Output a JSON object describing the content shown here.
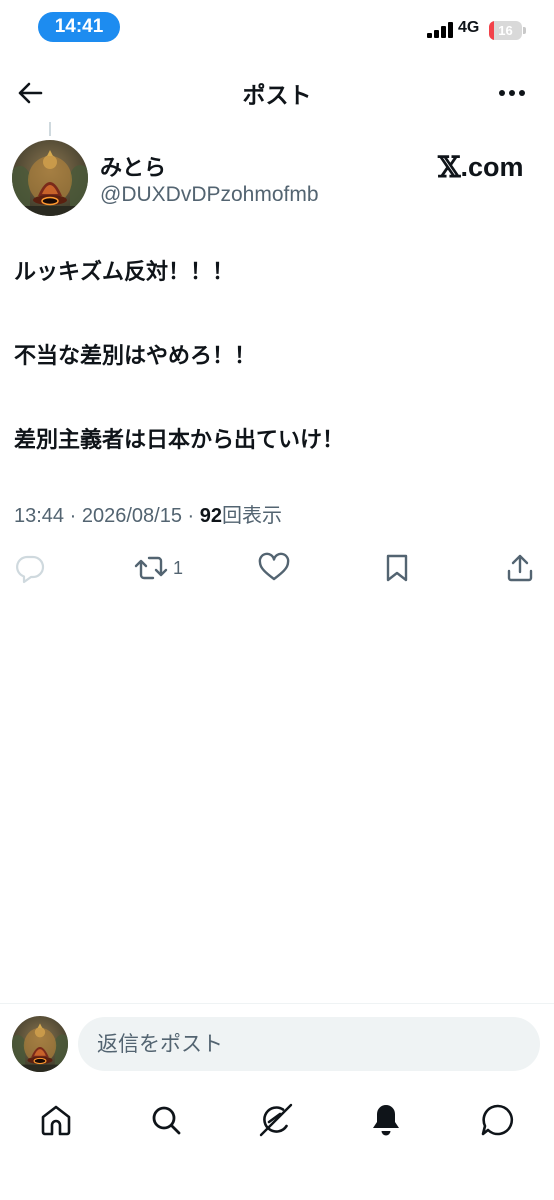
{
  "status_bar": {
    "time": "14:41",
    "network": "4G",
    "battery": "16",
    "battery_level": 0.16
  },
  "header": {
    "title": "ポスト",
    "back_icon": "arrow-left-icon",
    "more_icon": "more-horizontal-icon"
  },
  "post": {
    "author_name": "みとら",
    "author_handle": "@DUXDvDPzohmofmb",
    "watermark_x": "𝕏",
    "watermark_domain": ".com",
    "lines": [
      "ルッキズム反対！！！",
      "不当な差別はやめろ！！",
      "差別主義者は日本から出ていけ！"
    ],
    "time": "13:44",
    "separator": "·",
    "date": "2026/08/15",
    "views_count": "92",
    "views_label": "回表示"
  },
  "actions": {
    "reply_icon": "reply-icon",
    "repost_icon": "repost-icon",
    "repost_count": "1",
    "like_icon": "heart-icon",
    "bookmark_icon": "bookmark-icon",
    "share_icon": "share-icon"
  },
  "reply_bar": {
    "placeholder": "返信をポスト"
  },
  "bottom_nav": [
    "home-icon",
    "search-icon",
    "grok-icon",
    "notifications-icon",
    "messages-icon"
  ],
  "colors": {
    "accent": "#1d9bf0",
    "time_pill": "#1d8cf0",
    "text": "#0f1419",
    "secondary": "#536471",
    "battery_low": "#f2424a"
  }
}
